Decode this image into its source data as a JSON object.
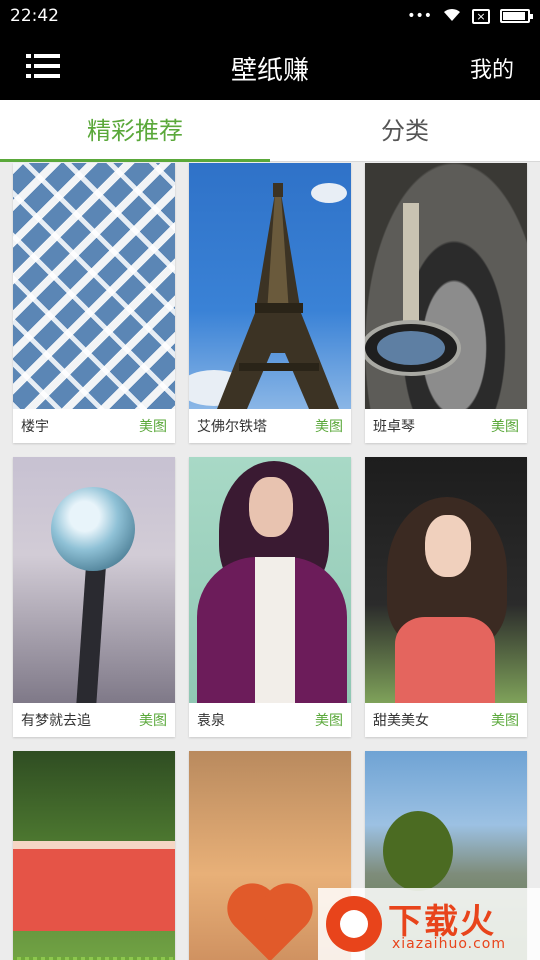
{
  "status_bar": {
    "time": "22:42",
    "dots": "•••",
    "wifi_icon": "wifi-icon",
    "battery_level": 0.92
  },
  "app_bar": {
    "title": "壁纸赚",
    "menu_icon": "menu-icon",
    "mine_label": "我的"
  },
  "tabs": [
    {
      "label": "精彩推荐",
      "active": true
    },
    {
      "label": "分类",
      "active": false
    }
  ],
  "wallpapers": [
    {
      "title": "楼宇",
      "tag": "美图"
    },
    {
      "title": "艾佛尔铁塔",
      "tag": "美图"
    },
    {
      "title": "班卓琴",
      "tag": "美图"
    },
    {
      "title": "有梦就去追",
      "tag": "美图"
    },
    {
      "title": "袁泉",
      "tag": "美图"
    },
    {
      "title": "甜美美女",
      "tag": "美图"
    },
    {
      "title": "",
      "tag": ""
    },
    {
      "title": "",
      "tag": ""
    },
    {
      "title": "",
      "tag": ""
    }
  ],
  "watermark": {
    "brand": "下载火",
    "site": "xiazaihuo.com"
  },
  "colors": {
    "accent": "#5aa83a",
    "appbar": "#000000",
    "watermark": "#e8441b"
  }
}
